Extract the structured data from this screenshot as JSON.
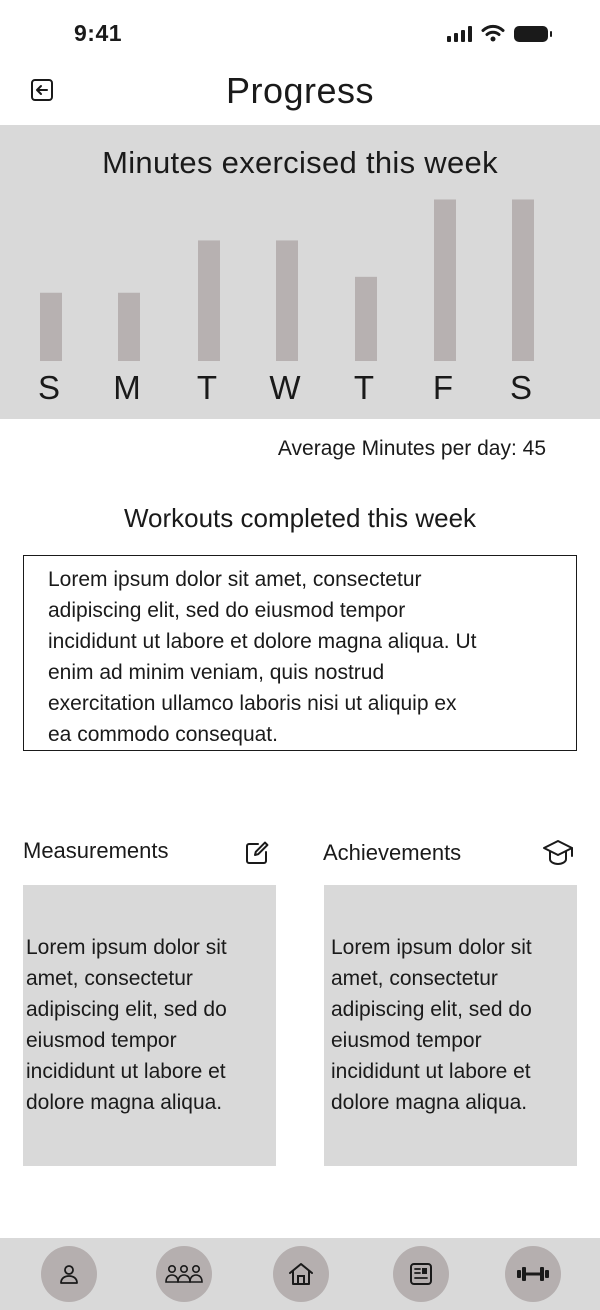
{
  "status_bar": {
    "time": "9:41"
  },
  "header": {
    "title": "Progress",
    "back_icon": "back-arrow-icon"
  },
  "chart_data": {
    "type": "bar",
    "title": "Minutes exercised this week",
    "categories": [
      "S",
      "M",
      "T",
      "W",
      "T",
      "F",
      "S"
    ],
    "values": [
      30,
      30,
      53,
      53,
      37,
      71,
      71
    ],
    "xlabel": "",
    "ylabel": "",
    "ylim": [
      0,
      80
    ],
    "grid": false,
    "bar_color": "#b7b1b1",
    "panel_color": "#d9d9d9"
  },
  "stats": {
    "average_label": "Average Minutes per day: 45"
  },
  "workouts": {
    "title": "Workouts completed this week",
    "lines": [
      "Lorem ipsum dolor sit amet, consectetur",
      "adipiscing elit, sed do eiusmod tempor",
      "incididunt ut labore et dolore magna aliqua. Ut",
      "enim ad minim veniam, quis nostrud",
      "exercitation ullamco laboris nisi ut aliquip ex",
      "ea commodo consequat."
    ]
  },
  "measurements": {
    "label": "Measurements",
    "icon": "edit-icon",
    "lines": [
      "Lorem ipsum dolor sit",
      "amet, consectetur",
      "adipiscing elit, sed do",
      "eiusmod tempor",
      "incididunt ut labore et",
      "dolore magna aliqua."
    ]
  },
  "achievements": {
    "label": "Achievements",
    "icon": "graduation-cap-icon",
    "lines": [
      "Lorem ipsum dolor sit",
      "amet, consectetur",
      "adipiscing elit, sed do",
      "eiusmod tempor",
      "incididunt ut labore et",
      "dolore magna aliqua."
    ]
  },
  "bottom_nav": {
    "items": [
      {
        "icon": "profile-icon"
      },
      {
        "icon": "community-icon"
      },
      {
        "icon": "home-icon"
      },
      {
        "icon": "log-icon"
      },
      {
        "icon": "dumbbell-icon"
      }
    ]
  },
  "colors": {
    "panel": "#d9d9d9",
    "bar": "#b7b1b1",
    "nav_button": "#b5afaf",
    "text": "#1a1a1a"
  }
}
